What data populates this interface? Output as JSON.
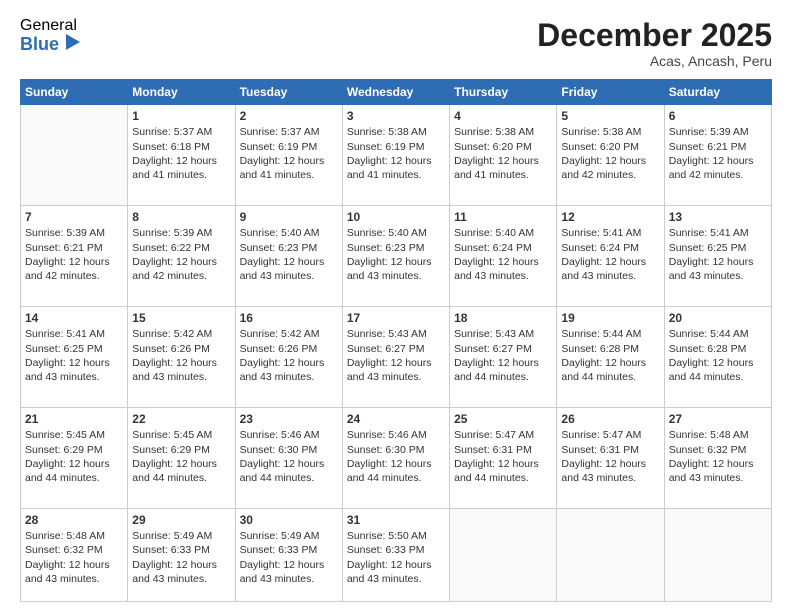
{
  "logo": {
    "general": "General",
    "blue": "Blue"
  },
  "header": {
    "month": "December 2025",
    "location": "Acas, Ancash, Peru"
  },
  "days": [
    "Sunday",
    "Monday",
    "Tuesday",
    "Wednesday",
    "Thursday",
    "Friday",
    "Saturday"
  ],
  "weeks": [
    [
      {
        "num": "",
        "sunrise": "",
        "sunset": "",
        "daylight": ""
      },
      {
        "num": "1",
        "sunrise": "Sunrise: 5:37 AM",
        "sunset": "Sunset: 6:18 PM",
        "daylight": "Daylight: 12 hours and 41 minutes."
      },
      {
        "num": "2",
        "sunrise": "Sunrise: 5:37 AM",
        "sunset": "Sunset: 6:19 PM",
        "daylight": "Daylight: 12 hours and 41 minutes."
      },
      {
        "num": "3",
        "sunrise": "Sunrise: 5:38 AM",
        "sunset": "Sunset: 6:19 PM",
        "daylight": "Daylight: 12 hours and 41 minutes."
      },
      {
        "num": "4",
        "sunrise": "Sunrise: 5:38 AM",
        "sunset": "Sunset: 6:20 PM",
        "daylight": "Daylight: 12 hours and 41 minutes."
      },
      {
        "num": "5",
        "sunrise": "Sunrise: 5:38 AM",
        "sunset": "Sunset: 6:20 PM",
        "daylight": "Daylight: 12 hours and 42 minutes."
      },
      {
        "num": "6",
        "sunrise": "Sunrise: 5:39 AM",
        "sunset": "Sunset: 6:21 PM",
        "daylight": "Daylight: 12 hours and 42 minutes."
      }
    ],
    [
      {
        "num": "7",
        "sunrise": "Sunrise: 5:39 AM",
        "sunset": "Sunset: 6:21 PM",
        "daylight": "Daylight: 12 hours and 42 minutes."
      },
      {
        "num": "8",
        "sunrise": "Sunrise: 5:39 AM",
        "sunset": "Sunset: 6:22 PM",
        "daylight": "Daylight: 12 hours and 42 minutes."
      },
      {
        "num": "9",
        "sunrise": "Sunrise: 5:40 AM",
        "sunset": "Sunset: 6:23 PM",
        "daylight": "Daylight: 12 hours and 43 minutes."
      },
      {
        "num": "10",
        "sunrise": "Sunrise: 5:40 AM",
        "sunset": "Sunset: 6:23 PM",
        "daylight": "Daylight: 12 hours and 43 minutes."
      },
      {
        "num": "11",
        "sunrise": "Sunrise: 5:40 AM",
        "sunset": "Sunset: 6:24 PM",
        "daylight": "Daylight: 12 hours and 43 minutes."
      },
      {
        "num": "12",
        "sunrise": "Sunrise: 5:41 AM",
        "sunset": "Sunset: 6:24 PM",
        "daylight": "Daylight: 12 hours and 43 minutes."
      },
      {
        "num": "13",
        "sunrise": "Sunrise: 5:41 AM",
        "sunset": "Sunset: 6:25 PM",
        "daylight": "Daylight: 12 hours and 43 minutes."
      }
    ],
    [
      {
        "num": "14",
        "sunrise": "Sunrise: 5:41 AM",
        "sunset": "Sunset: 6:25 PM",
        "daylight": "Daylight: 12 hours and 43 minutes."
      },
      {
        "num": "15",
        "sunrise": "Sunrise: 5:42 AM",
        "sunset": "Sunset: 6:26 PM",
        "daylight": "Daylight: 12 hours and 43 minutes."
      },
      {
        "num": "16",
        "sunrise": "Sunrise: 5:42 AM",
        "sunset": "Sunset: 6:26 PM",
        "daylight": "Daylight: 12 hours and 43 minutes."
      },
      {
        "num": "17",
        "sunrise": "Sunrise: 5:43 AM",
        "sunset": "Sunset: 6:27 PM",
        "daylight": "Daylight: 12 hours and 43 minutes."
      },
      {
        "num": "18",
        "sunrise": "Sunrise: 5:43 AM",
        "sunset": "Sunset: 6:27 PM",
        "daylight": "Daylight: 12 hours and 44 minutes."
      },
      {
        "num": "19",
        "sunrise": "Sunrise: 5:44 AM",
        "sunset": "Sunset: 6:28 PM",
        "daylight": "Daylight: 12 hours and 44 minutes."
      },
      {
        "num": "20",
        "sunrise": "Sunrise: 5:44 AM",
        "sunset": "Sunset: 6:28 PM",
        "daylight": "Daylight: 12 hours and 44 minutes."
      }
    ],
    [
      {
        "num": "21",
        "sunrise": "Sunrise: 5:45 AM",
        "sunset": "Sunset: 6:29 PM",
        "daylight": "Daylight: 12 hours and 44 minutes."
      },
      {
        "num": "22",
        "sunrise": "Sunrise: 5:45 AM",
        "sunset": "Sunset: 6:29 PM",
        "daylight": "Daylight: 12 hours and 44 minutes."
      },
      {
        "num": "23",
        "sunrise": "Sunrise: 5:46 AM",
        "sunset": "Sunset: 6:30 PM",
        "daylight": "Daylight: 12 hours and 44 minutes."
      },
      {
        "num": "24",
        "sunrise": "Sunrise: 5:46 AM",
        "sunset": "Sunset: 6:30 PM",
        "daylight": "Daylight: 12 hours and 44 minutes."
      },
      {
        "num": "25",
        "sunrise": "Sunrise: 5:47 AM",
        "sunset": "Sunset: 6:31 PM",
        "daylight": "Daylight: 12 hours and 44 minutes."
      },
      {
        "num": "26",
        "sunrise": "Sunrise: 5:47 AM",
        "sunset": "Sunset: 6:31 PM",
        "daylight": "Daylight: 12 hours and 43 minutes."
      },
      {
        "num": "27",
        "sunrise": "Sunrise: 5:48 AM",
        "sunset": "Sunset: 6:32 PM",
        "daylight": "Daylight: 12 hours and 43 minutes."
      }
    ],
    [
      {
        "num": "28",
        "sunrise": "Sunrise: 5:48 AM",
        "sunset": "Sunset: 6:32 PM",
        "daylight": "Daylight: 12 hours and 43 minutes."
      },
      {
        "num": "29",
        "sunrise": "Sunrise: 5:49 AM",
        "sunset": "Sunset: 6:33 PM",
        "daylight": "Daylight: 12 hours and 43 minutes."
      },
      {
        "num": "30",
        "sunrise": "Sunrise: 5:49 AM",
        "sunset": "Sunset: 6:33 PM",
        "daylight": "Daylight: 12 hours and 43 minutes."
      },
      {
        "num": "31",
        "sunrise": "Sunrise: 5:50 AM",
        "sunset": "Sunset: 6:33 PM",
        "daylight": "Daylight: 12 hours and 43 minutes."
      },
      {
        "num": "",
        "sunrise": "",
        "sunset": "",
        "daylight": ""
      },
      {
        "num": "",
        "sunrise": "",
        "sunset": "",
        "daylight": ""
      },
      {
        "num": "",
        "sunrise": "",
        "sunset": "",
        "daylight": ""
      }
    ]
  ]
}
